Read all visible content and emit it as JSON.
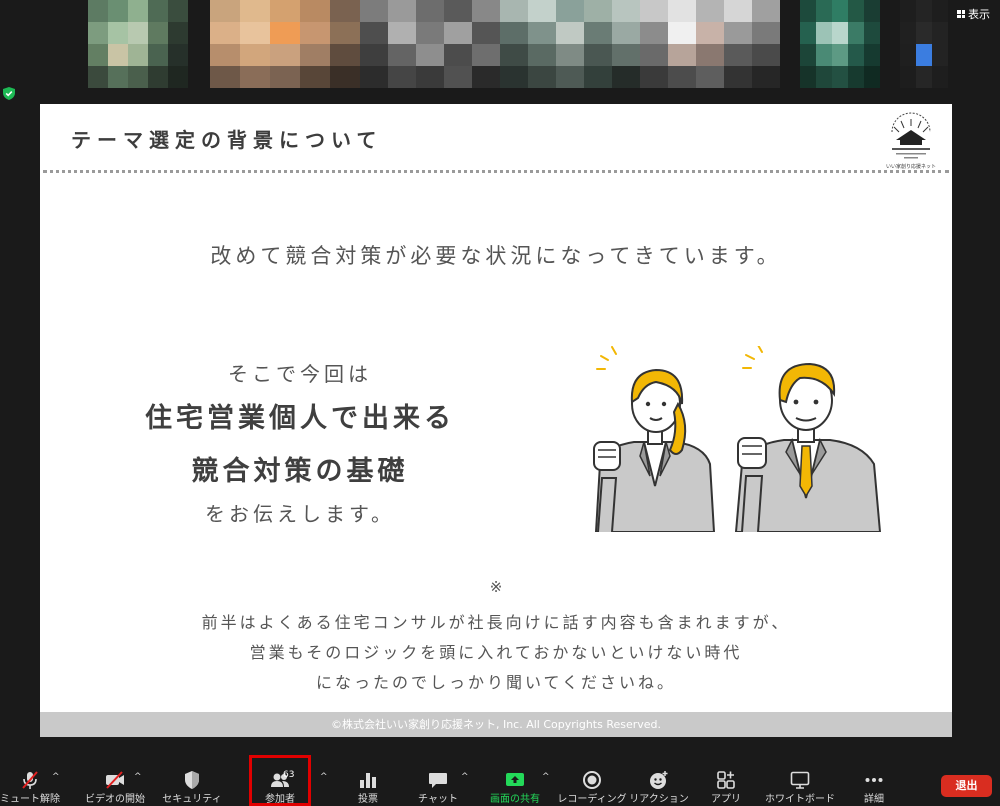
{
  "top_bar": {
    "view_label": "表示"
  },
  "slide": {
    "title": "テーマ選定の背景について",
    "lead": "改めて競合対策が必要な状況になってきています。",
    "intro": "そこで今回は",
    "headline_1": "住宅営業個人で出来る",
    "headline_2": "競合対策の基礎",
    "outro": "をお伝えします。",
    "note_mark": "※",
    "note_lines": [
      "前半はよくある住宅コンサルが社長向けに話す内容も含まれますが、",
      "営業もそのロジックを頭に入れておかないといけない時代",
      "になったのでしっかり聞いてくださいね。"
    ],
    "copyright": "©株式会社いい家創り応援ネット, Inc. All Copyrights Reserved.",
    "logo_caption": "いい家創り応援ネット"
  },
  "toolbar": {
    "unmute": "ミュート解除",
    "start_video": "ビデオの開始",
    "security": "セキュリティ",
    "participants": "参加者",
    "participant_count": "63",
    "polls": "投票",
    "chat": "チャット",
    "share_screen": "画面の共有",
    "recording": "レコーディング",
    "reactions": "リアクション",
    "apps": "アプリ",
    "whiteboard": "ホワイトボード",
    "more": "詳細",
    "leave": "退出"
  },
  "colors": {
    "leave_red": "#d92d20",
    "share_green": "#23d959",
    "highlight_red": "#e00000",
    "security_green": "#1db954"
  }
}
